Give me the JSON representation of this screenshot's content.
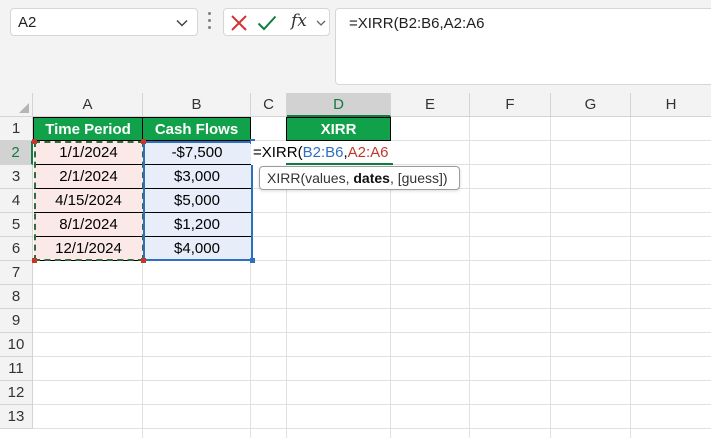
{
  "formula_bar": {
    "name_box": "A2",
    "fx_label": "fx",
    "formula": "=XIRR(B2:B6,A2:A6"
  },
  "columns": [
    "A",
    "B",
    "C",
    "D",
    "E",
    "F",
    "G",
    "H"
  ],
  "rows": [
    "1",
    "2",
    "3",
    "4",
    "5",
    "6",
    "7",
    "8",
    "9",
    "10",
    "11",
    "12",
    "13"
  ],
  "headers": {
    "a1": "Time Period",
    "b1": "Cash Flows",
    "d1": "XIRR"
  },
  "table": [
    {
      "date": "1/1/2024",
      "flow": "-$7,500"
    },
    {
      "date": "2/1/2024",
      "flow": "$3,000"
    },
    {
      "date": "4/15/2024",
      "flow": "$5,000"
    },
    {
      "date": "8/1/2024",
      "flow": "$1,200"
    },
    {
      "date": "12/1/2024",
      "flow": "$4,000"
    }
  ],
  "edit_cell": {
    "prefix": "=XIRR(",
    "ref_values": "B2:B6",
    "comma": ",",
    "ref_dates": "A2:A6"
  },
  "tooltip": {
    "func": "XIRR(",
    "arg1": "values, ",
    "arg2": "dates",
    "arg3": ", [guess])"
  },
  "colors": {
    "header_fill": "#12a14b",
    "dates_fill": "#fbe9e7",
    "values_fill": "#e7eef9",
    "range_blue": "#2f6fbf",
    "range_red": "#c0392b",
    "excel_green": "#107c41"
  }
}
